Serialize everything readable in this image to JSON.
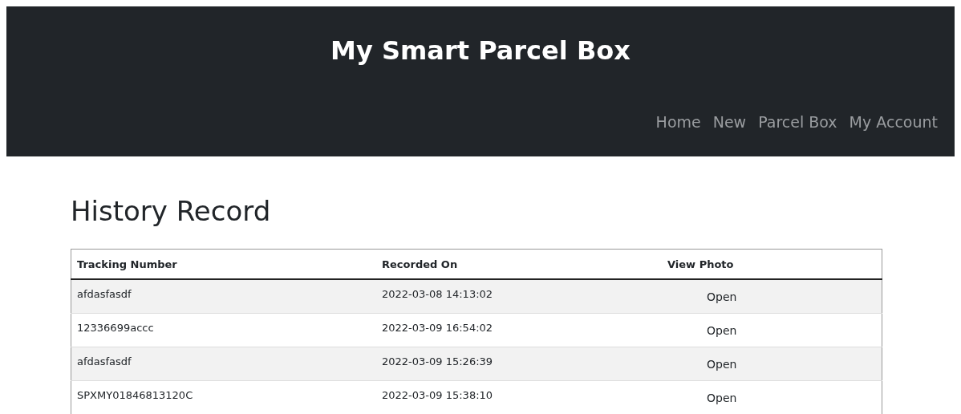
{
  "header": {
    "title": "My Smart Parcel Box",
    "nav": [
      "Home",
      "New",
      "Parcel Box",
      "My Account"
    ]
  },
  "page": {
    "heading": "History Record"
  },
  "table": {
    "columns": [
      "Tracking Number",
      "Recorded On",
      "View Photo"
    ],
    "rows": [
      {
        "tracking_number": "afdasfasdf",
        "recorded_on": "2022-03-08 14:13:02",
        "action": "Open"
      },
      {
        "tracking_number": "12336699accc",
        "recorded_on": "2022-03-09 16:54:02",
        "action": "Open"
      },
      {
        "tracking_number": "afdasfasdf",
        "recorded_on": "2022-03-09 15:26:39",
        "action": "Open"
      },
      {
        "tracking_number": "SPXMY01846813120C",
        "recorded_on": "2022-03-09 15:38:10",
        "action": "Open"
      }
    ]
  }
}
